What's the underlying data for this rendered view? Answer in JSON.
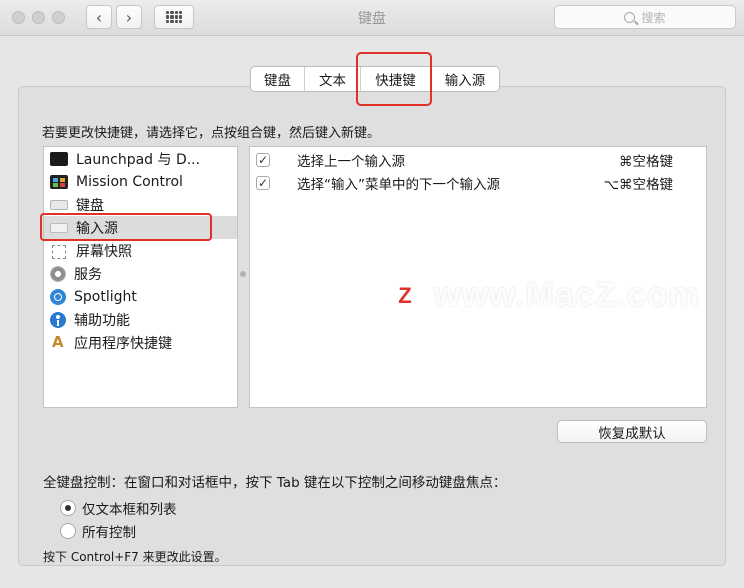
{
  "window": {
    "title": "键盘",
    "search_placeholder": "搜索"
  },
  "tabs": [
    {
      "label": "键盘",
      "selected": false
    },
    {
      "label": "文本",
      "selected": false
    },
    {
      "label": "快捷键",
      "selected": true
    },
    {
      "label": "输入源",
      "selected": false
    }
  ],
  "instruction": "若要更改快捷键，请选择它，点按组合键，然后键入新键。",
  "categories": [
    {
      "label": "Launchpad 与 D...",
      "icon": "launchpad-icon"
    },
    {
      "label": "Mission Control",
      "icon": "mission-control-icon"
    },
    {
      "label": "键盘",
      "icon": "keyboard-icon"
    },
    {
      "label": "输入源",
      "icon": "input-source-icon",
      "selected": true
    },
    {
      "label": "屏幕快照",
      "icon": "screenshot-icon"
    },
    {
      "label": "服务",
      "icon": "gear-icon"
    },
    {
      "label": "Spotlight",
      "icon": "spotlight-icon"
    },
    {
      "label": "辅助功能",
      "icon": "accessibility-icon"
    },
    {
      "label": "应用程序快捷键",
      "icon": "app-shortcuts-icon"
    }
  ],
  "shortcuts": [
    {
      "label": "选择上一个输入源",
      "key": "⌘空格键",
      "checked": true
    },
    {
      "label": "选择“输入”菜单中的下一个输入源",
      "key": "⌥⌘空格键",
      "checked": true
    }
  ],
  "restore_button": "恢复成默认",
  "full_keyboard": {
    "label": "全键盘控制：在窗口和对话框中，按下 Tab 键在以下控制之间移动键盘焦点：",
    "options": [
      {
        "label": "仅文本框和列表",
        "selected": true
      },
      {
        "label": "所有控制",
        "selected": false
      }
    ],
    "hint": "按下 Control+F7 来更改此设置。"
  },
  "watermark": {
    "logo": "Z",
    "text": "www.MacZ.com"
  },
  "colors": {
    "highlight_red": "#e0302a",
    "selected_row": "#dcdcdc"
  }
}
